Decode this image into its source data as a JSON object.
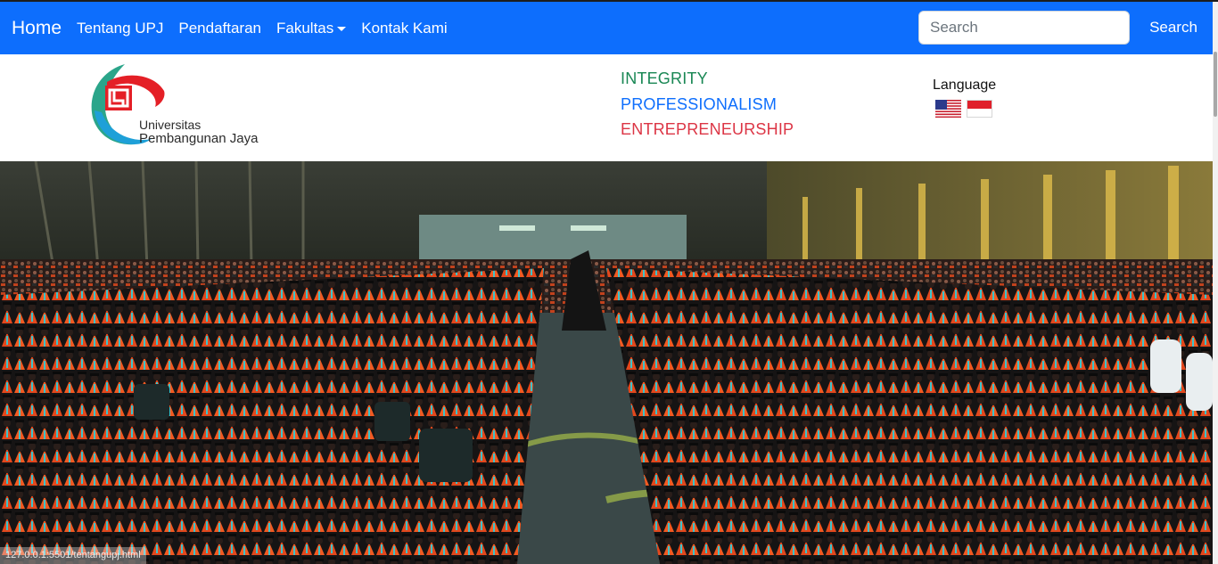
{
  "navbar": {
    "brand": "Home",
    "links": [
      "Tentang UPJ",
      "Pendaftaran",
      "Fakultas",
      "Kontak Kami"
    ],
    "search_placeholder": "Search",
    "search_button": "Search",
    "bg_color": "#0d6efd"
  },
  "header": {
    "logo_line1": "Universitas",
    "logo_line2": "Pembangunan Jaya",
    "values": [
      "INTEGRITY",
      "PROFESSIONALISM",
      "ENTREPRENEURSHIP"
    ],
    "value_colors": [
      "#198754",
      "#0d6efd",
      "#dc3545"
    ],
    "language_label": "Language",
    "flags": [
      "us-flag-icon",
      "indonesia-flag-icon"
    ]
  },
  "hero": {
    "image": "graduation-ceremony-photo"
  },
  "status_bar": {
    "url": "127.0.0.1:5501/tentangupj.html"
  }
}
